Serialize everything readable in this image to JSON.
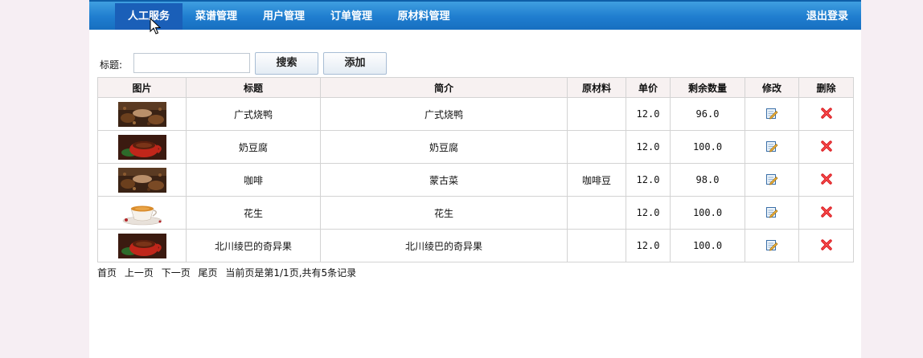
{
  "nav": {
    "items": [
      {
        "label": "人工服务"
      },
      {
        "label": "菜谱管理"
      },
      {
        "label": "用户管理"
      },
      {
        "label": "订单管理"
      },
      {
        "label": "原材料管理"
      }
    ],
    "logout": "退出登录"
  },
  "search": {
    "label": "标题:",
    "value": "",
    "search_button": "搜索",
    "add_button": "添加"
  },
  "table": {
    "headers": [
      "图片",
      "标题",
      "简介",
      "原材料",
      "单价",
      "剩余数量",
      "修改",
      "删除"
    ],
    "rows": [
      {
        "image": "coffee-beans",
        "title": "广式烧鸭",
        "intro": "广式烧鸭",
        "material": "",
        "price": "12.0",
        "stock": "96.0"
      },
      {
        "image": "red-cup",
        "title": "奶豆腐",
        "intro": "奶豆腐",
        "material": "",
        "price": "12.0",
        "stock": "100.0"
      },
      {
        "image": "coffee-beans",
        "title": "咖啡",
        "intro": "蒙古菜",
        "material": "咖啡豆",
        "price": "12.0",
        "stock": "98.0"
      },
      {
        "image": "tea-cup",
        "title": "花生",
        "intro": "花生",
        "material": "",
        "price": "12.0",
        "stock": "100.0"
      },
      {
        "image": "red-cup",
        "title": "北川绫巴的奇异果",
        "intro": "北川绫巴的奇异果",
        "material": "",
        "price": "12.0",
        "stock": "100.0"
      }
    ]
  },
  "pager": {
    "first": "首页",
    "prev": "上一页",
    "next": "下一页",
    "last": "尾页",
    "summary": "当前页是第1/1页,共有5条记录"
  },
  "colors": {
    "nav_blue": "#1f7dcf",
    "nav_active": "#1a5fb8",
    "header_bg": "#f7f1f1",
    "delete_red": "#d8161b"
  }
}
